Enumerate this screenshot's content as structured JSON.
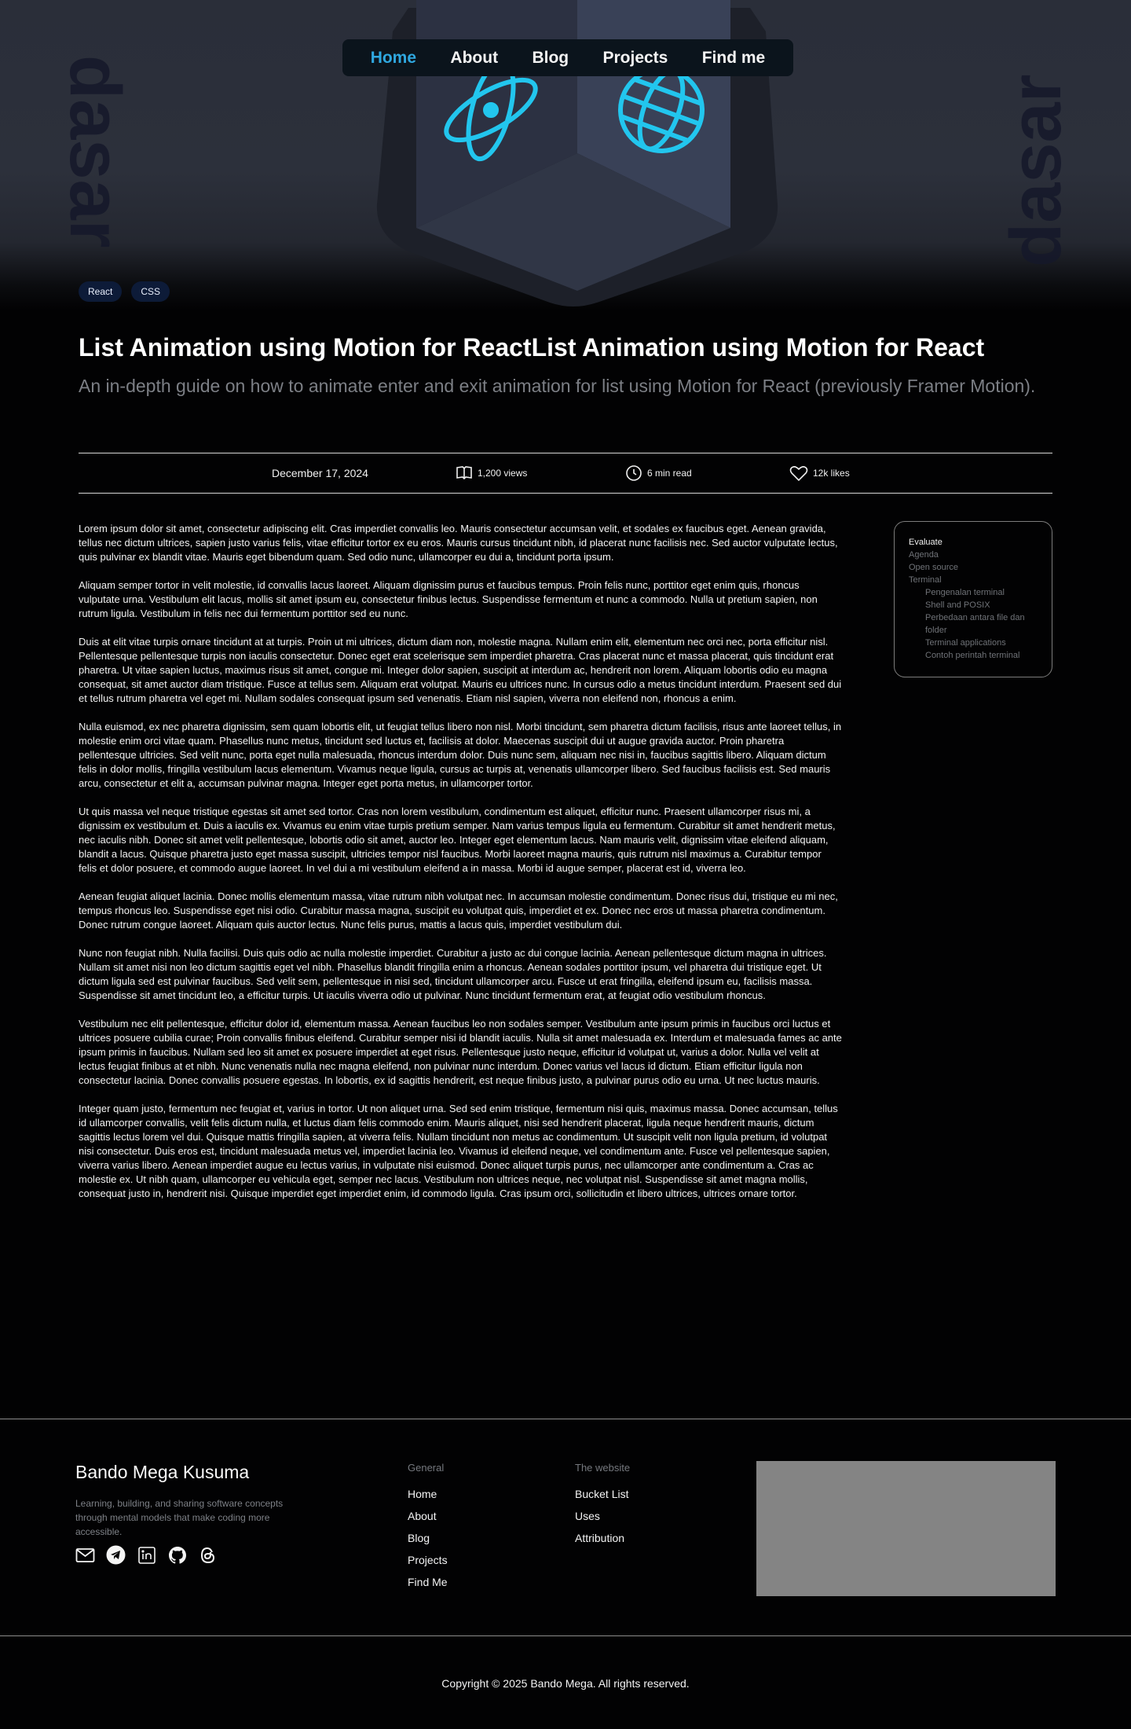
{
  "nav": {
    "items": [
      {
        "label": "Home",
        "active": true
      },
      {
        "label": "About"
      },
      {
        "label": "Blog"
      },
      {
        "label": "Projects"
      },
      {
        "label": "Find me"
      }
    ]
  },
  "hero": {
    "watermark_left": "dasar",
    "watermark_right": "dasar",
    "tags": [
      "React",
      "CSS"
    ]
  },
  "post": {
    "title": "List Animation using Motion for ReactList Animation using Motion for React",
    "subtitle": "An in-depth guide on how to animate enter and exit animation for list using Motion for React (previously Framer Motion)."
  },
  "meta": {
    "date": "December 17, 2024",
    "views": "1,200 views",
    "read_time": "6 min read",
    "likes": "12k likes"
  },
  "article": {
    "paragraphs": [
      "Lorem ipsum dolor sit amet, consectetur adipiscing elit. Cras imperdiet convallis leo. Mauris consectetur accumsan velit, et sodales ex faucibus eget. Aenean gravida, tellus nec dictum ultrices, sapien justo varius felis, vitae efficitur tortor ex eu eros. Mauris cursus tincidunt nibh, id placerat nunc facilisis nec. Sed auctor vulputate lectus, quis pulvinar ex blandit vitae. Mauris eget bibendum quam. Sed odio nunc, ullamcorper eu dui a, tincidunt porta ipsum.",
      "Aliquam semper tortor in velit molestie, id convallis lacus laoreet. Aliquam dignissim purus et faucibus tempus. Proin felis nunc, porttitor eget enim quis, rhoncus vulputate urna. Vestibulum elit lacus, mollis sit amet ipsum eu, consectetur finibus lectus. Suspendisse fermentum et nunc a commodo. Nulla ut pretium sapien, non rutrum ligula. Vestibulum in felis nec dui fermentum porttitor sed eu nunc.",
      "Duis at elit vitae turpis ornare tincidunt at at turpis. Proin ut mi ultrices, dictum diam non, molestie magna. Nullam enim elit, elementum nec orci nec, porta efficitur nisl. Pellentesque pellentesque turpis non iaculis consectetur. Donec eget erat scelerisque sem imperdiet pharetra. Cras placerat nunc et massa placerat, quis tincidunt erat pharetra. Ut vitae sapien luctus, maximus risus sit amet, congue mi. Integer dolor sapien, suscipit at interdum ac, hendrerit non lorem. Aliquam lobortis odio eu magna consequat, sit amet auctor diam tristique. Fusce at tellus sem. Aliquam erat volutpat. Mauris eu ultrices nunc. In cursus odio a metus tincidunt interdum. Praesent sed dui et tellus rutrum pharetra vel eget mi. Nullam sodales consequat ipsum sed venenatis. Etiam nisl sapien, viverra non eleifend non, rhoncus a enim.",
      "Nulla euismod, ex nec pharetra dignissim, sem quam lobortis elit, ut feugiat tellus libero non nisl. Morbi tincidunt, sem pharetra dictum facilisis, risus ante laoreet tellus, in molestie enim orci vitae quam. Phasellus nunc metus, tincidunt sed luctus et, facilisis at dolor. Maecenas suscipit dui ut augue gravida auctor. Proin pharetra pellentesque ultricies. Sed velit nunc, porta eget nulla malesuada, rhoncus interdum dolor. Duis nunc sem, aliquam nec nisi in, faucibus sagittis libero. Aliquam dictum felis in dolor mollis, fringilla vestibulum lacus elementum. Vivamus neque ligula, cursus ac turpis at, venenatis ullamcorper libero. Sed faucibus facilisis est. Sed mauris arcu, consectetur et elit a, accumsan pulvinar magna. Integer eget porta metus, in ullamcorper tortor.",
      "Ut quis massa vel neque tristique egestas sit amet sed tortor. Cras non lorem vestibulum, condimentum est aliquet, efficitur nunc. Praesent ullamcorper risus mi, a dignissim ex vestibulum et. Duis a iaculis ex. Vivamus eu enim vitae turpis pretium semper. Nam varius tempus ligula eu fermentum. Curabitur sit amet hendrerit metus, nec iaculis nibh. Donec sit amet velit pellentesque, lobortis odio sit amet, auctor leo. Integer eget elementum lacus. Nam mauris velit, dignissim vitae eleifend aliquam, blandit a lacus. Quisque pharetra justo eget massa suscipit, ultricies tempor nisl faucibus. Morbi laoreet magna mauris, quis rutrum nisl maximus a. Curabitur tempor felis et dolor posuere, et commodo augue laoreet. In vel dui a mi vestibulum eleifend a in massa. Morbi id augue semper, placerat est id, viverra leo.",
      "Aenean feugiat aliquet lacinia. Donec mollis elementum massa, vitae rutrum nibh volutpat nec. In accumsan molestie condimentum. Donec risus dui, tristique eu mi nec, tempus rhoncus leo. Suspendisse eget nisi odio. Curabitur massa magna, suscipit eu volutpat quis, imperdiet et ex. Donec nec eros ut massa pharetra condimentum. Donec rutrum congue laoreet. Aliquam quis auctor lectus. Nunc felis purus, mattis a lacus quis, imperdiet vestibulum dui.",
      "Nunc non feugiat nibh. Nulla facilisi. Duis quis odio ac nulla molestie imperdiet. Curabitur a justo ac dui congue lacinia. Aenean pellentesque dictum magna in ultrices. Nullam sit amet nisi non leo dictum sagittis eget vel nibh. Phasellus blandit fringilla enim a rhoncus. Aenean sodales porttitor ipsum, vel pharetra dui tristique eget. Ut dictum ligula sed est pulvinar faucibus. Sed velit sem, pellentesque in nisi sed, tincidunt ullamcorper arcu. Fusce ut erat fringilla, eleifend ipsum eu, facilisis massa. Suspendisse sit amet tincidunt leo, a efficitur turpis. Ut iaculis viverra odio ut pulvinar. Nunc tincidunt fermentum erat, at feugiat odio vestibulum rhoncus.",
      "Vestibulum nec elit pellentesque, efficitur dolor id, elementum massa. Aenean faucibus leo non sodales semper. Vestibulum ante ipsum primis in faucibus orci luctus et ultrices posuere cubilia curae; Proin convallis finibus eleifend. Curabitur semper nisi id blandit iaculis. Nulla sit amet malesuada ex. Interdum et malesuada fames ac ante ipsum primis in faucibus. Nullam sed leo sit amet ex posuere imperdiet at eget risus. Pellentesque justo neque, efficitur id volutpat ut, varius a dolor. Nulla vel velit at lectus feugiat finibus at et nibh. Nunc venenatis nulla nec magna eleifend, non pulvinar nunc interdum. Donec varius vel lacus id dictum. Etiam efficitur ligula non consectetur lacinia. Donec convallis posuere egestas. In lobortis, ex id sagittis hendrerit, est neque finibus justo, a pulvinar purus odio eu urna. Ut nec luctus mauris.",
      "Integer quam justo, fermentum nec feugiat et, varius in tortor. Ut non aliquet urna. Sed sed enim tristique, fermentum nisi quis, maximus massa. Donec accumsan, tellus id ullamcorper convallis, velit felis dictum nulla, et luctus diam felis commodo enim. Mauris aliquet, nisi sed hendrerit placerat, ligula neque hendrerit mauris, dictum sagittis lectus lorem vel dui. Quisque mattis fringilla sapien, at viverra felis. Nullam tincidunt non metus ac condimentum. Ut suscipit velit non ligula pretium, id volutpat nisi consectetur. Duis eros est, tincidunt malesuada metus vel, imperdiet lacinia leo. Vivamus id eleifend neque, vel condimentum ante. Fusce vel pellentesque sapien, viverra varius libero. Aenean imperdiet augue eu lectus varius, in vulputate nisi euismod. Donec aliquet turpis purus, nec ullamcorper ante condimentum a. Cras ac molestie ex. Ut nibh quam, ullamcorper eu vehicula eget, semper nec lacus. Vestibulum non ultrices neque, nec volutpat nisl. Suspendisse sit amet magna mollis, consequat justo in, hendrerit nisi. Quisque imperdiet eget imperdiet enim, id commodo ligula. Cras ipsum orci, sollicitudin et libero ultrices, ultrices ornare tortor."
    ]
  },
  "toc": {
    "items": [
      {
        "label": "Evaluate",
        "level": 1,
        "current": true
      },
      {
        "label": "Agenda",
        "level": 1
      },
      {
        "label": "Open source",
        "level": 1
      },
      {
        "label": "Terminal",
        "level": 1
      },
      {
        "label": "Pengenalan terminal",
        "level": 2
      },
      {
        "label": "Shell and POSIX",
        "level": 2
      },
      {
        "label": "Perbedaan antara file dan folder",
        "level": 2
      },
      {
        "label": "Terminal applications",
        "level": 2
      },
      {
        "label": "Contoh perintah terminal",
        "level": 2
      }
    ]
  },
  "footer": {
    "brand": "Bando Mega Kusuma",
    "description": "Learning, building, and sharing software concepts through mental models that make coding more accessible.",
    "socials": [
      "mail-icon",
      "telegram-icon",
      "linkedin-icon",
      "github-icon",
      "threads-icon"
    ],
    "general": {
      "heading": "General",
      "links": [
        "Home",
        "About",
        "Blog",
        "Projects",
        "Find Me"
      ]
    },
    "website": {
      "heading": "The website",
      "links": [
        "Bucket List",
        "Uses",
        "Attribution"
      ]
    },
    "copyright": "Copyright © 2025 Bando Mega. All rights reserved."
  },
  "colors": {
    "accent": "#2fa8e0",
    "icon_cyan": "#22c6ee",
    "background": "#020203",
    "tag_bg": "#0d1b38"
  }
}
